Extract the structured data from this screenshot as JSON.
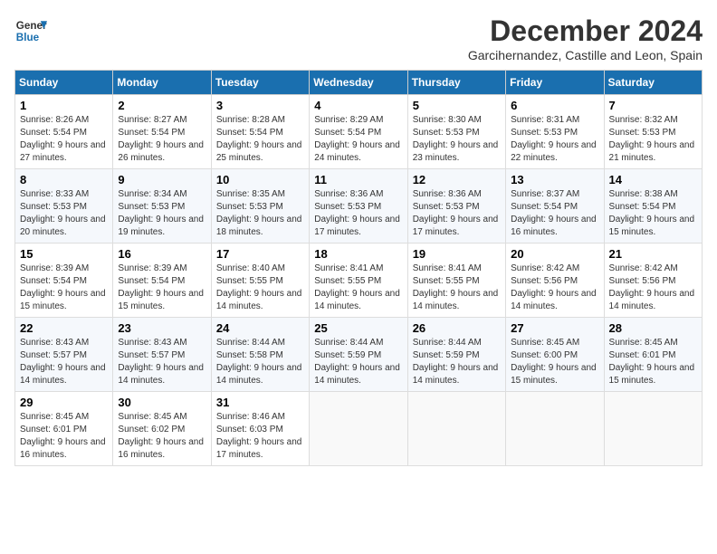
{
  "logo": {
    "line1": "General",
    "line2": "Blue"
  },
  "title": "December 2024",
  "location": "Garcihernandez, Castille and Leon, Spain",
  "days_of_week": [
    "Sunday",
    "Monday",
    "Tuesday",
    "Wednesday",
    "Thursday",
    "Friday",
    "Saturday"
  ],
  "weeks": [
    [
      {
        "day": "1",
        "sunrise": "8:26 AM",
        "sunset": "5:54 PM",
        "daylight": "9 hours and 27 minutes."
      },
      {
        "day": "2",
        "sunrise": "8:27 AM",
        "sunset": "5:54 PM",
        "daylight": "9 hours and 26 minutes."
      },
      {
        "day": "3",
        "sunrise": "8:28 AM",
        "sunset": "5:54 PM",
        "daylight": "9 hours and 25 minutes."
      },
      {
        "day": "4",
        "sunrise": "8:29 AM",
        "sunset": "5:54 PM",
        "daylight": "9 hours and 24 minutes."
      },
      {
        "day": "5",
        "sunrise": "8:30 AM",
        "sunset": "5:53 PM",
        "daylight": "9 hours and 23 minutes."
      },
      {
        "day": "6",
        "sunrise": "8:31 AM",
        "sunset": "5:53 PM",
        "daylight": "9 hours and 22 minutes."
      },
      {
        "day": "7",
        "sunrise": "8:32 AM",
        "sunset": "5:53 PM",
        "daylight": "9 hours and 21 minutes."
      }
    ],
    [
      {
        "day": "8",
        "sunrise": "8:33 AM",
        "sunset": "5:53 PM",
        "daylight": "9 hours and 20 minutes."
      },
      {
        "day": "9",
        "sunrise": "8:34 AM",
        "sunset": "5:53 PM",
        "daylight": "9 hours and 19 minutes."
      },
      {
        "day": "10",
        "sunrise": "8:35 AM",
        "sunset": "5:53 PM",
        "daylight": "9 hours and 18 minutes."
      },
      {
        "day": "11",
        "sunrise": "8:36 AM",
        "sunset": "5:53 PM",
        "daylight": "9 hours and 17 minutes."
      },
      {
        "day": "12",
        "sunrise": "8:36 AM",
        "sunset": "5:53 PM",
        "daylight": "9 hours and 17 minutes."
      },
      {
        "day": "13",
        "sunrise": "8:37 AM",
        "sunset": "5:54 PM",
        "daylight": "9 hours and 16 minutes."
      },
      {
        "day": "14",
        "sunrise": "8:38 AM",
        "sunset": "5:54 PM",
        "daylight": "9 hours and 15 minutes."
      }
    ],
    [
      {
        "day": "15",
        "sunrise": "8:39 AM",
        "sunset": "5:54 PM",
        "daylight": "9 hours and 15 minutes."
      },
      {
        "day": "16",
        "sunrise": "8:39 AM",
        "sunset": "5:54 PM",
        "daylight": "9 hours and 15 minutes."
      },
      {
        "day": "17",
        "sunrise": "8:40 AM",
        "sunset": "5:55 PM",
        "daylight": "9 hours and 14 minutes."
      },
      {
        "day": "18",
        "sunrise": "8:41 AM",
        "sunset": "5:55 PM",
        "daylight": "9 hours and 14 minutes."
      },
      {
        "day": "19",
        "sunrise": "8:41 AM",
        "sunset": "5:55 PM",
        "daylight": "9 hours and 14 minutes."
      },
      {
        "day": "20",
        "sunrise": "8:42 AM",
        "sunset": "5:56 PM",
        "daylight": "9 hours and 14 minutes."
      },
      {
        "day": "21",
        "sunrise": "8:42 AM",
        "sunset": "5:56 PM",
        "daylight": "9 hours and 14 minutes."
      }
    ],
    [
      {
        "day": "22",
        "sunrise": "8:43 AM",
        "sunset": "5:57 PM",
        "daylight": "9 hours and 14 minutes."
      },
      {
        "day": "23",
        "sunrise": "8:43 AM",
        "sunset": "5:57 PM",
        "daylight": "9 hours and 14 minutes."
      },
      {
        "day": "24",
        "sunrise": "8:44 AM",
        "sunset": "5:58 PM",
        "daylight": "9 hours and 14 minutes."
      },
      {
        "day": "25",
        "sunrise": "8:44 AM",
        "sunset": "5:59 PM",
        "daylight": "9 hours and 14 minutes."
      },
      {
        "day": "26",
        "sunrise": "8:44 AM",
        "sunset": "5:59 PM",
        "daylight": "9 hours and 14 minutes."
      },
      {
        "day": "27",
        "sunrise": "8:45 AM",
        "sunset": "6:00 PM",
        "daylight": "9 hours and 15 minutes."
      },
      {
        "day": "28",
        "sunrise": "8:45 AM",
        "sunset": "6:01 PM",
        "daylight": "9 hours and 15 minutes."
      }
    ],
    [
      {
        "day": "29",
        "sunrise": "8:45 AM",
        "sunset": "6:01 PM",
        "daylight": "9 hours and 16 minutes."
      },
      {
        "day": "30",
        "sunrise": "8:45 AM",
        "sunset": "6:02 PM",
        "daylight": "9 hours and 16 minutes."
      },
      {
        "day": "31",
        "sunrise": "8:46 AM",
        "sunset": "6:03 PM",
        "daylight": "9 hours and 17 minutes."
      },
      null,
      null,
      null,
      null
    ]
  ]
}
